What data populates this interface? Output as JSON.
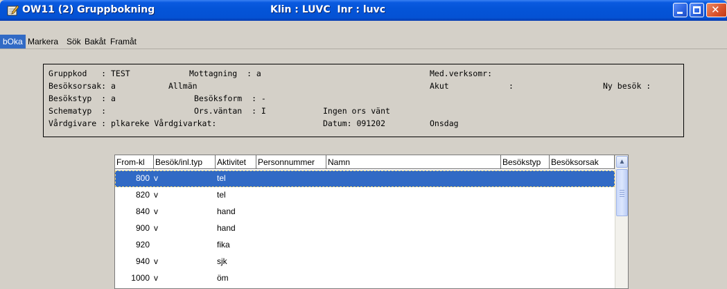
{
  "window": {
    "app_title": "OW11 (2) Gruppbokning",
    "clinic_title": "Klin : LUVC  Inr : luvc",
    "icon": "pencil-notepad-icon",
    "controls": [
      "minimize-icon",
      "maximize-icon",
      "close-icon"
    ]
  },
  "menu": {
    "items": [
      "bOka",
      "Markera",
      "Sök",
      "Bakåt",
      "Framåt"
    ],
    "active_index": 0
  },
  "info": {
    "lines": [
      "Gruppkod   : TEST",
      "Besöksorsak: a",
      "Besökstyp  : a",
      "Schematyp  :",
      "Vårdgivare : plkareke Vårdgivarkat:"
    ],
    "col2": [
      "Mottagning  : a",
      "Allmän",
      "Besöksform  : -",
      "Ors.väntan  : I",
      ""
    ],
    "ingen_ors": "Ingen ors vänt",
    "datum": "Datum: 091202",
    "weekday": "Onsdag",
    "med_verksomr": "Med.verksomr:",
    "akut": "Akut",
    "akut_colon": ":",
    "ny_besok": "Ny besök :"
  },
  "grid": {
    "columns": [
      "From-kl",
      "Besök/inl.typ",
      "Aktivitet",
      "Personnummer",
      "Namn",
      "Besökstyp",
      "Besöksorsak"
    ],
    "rows": [
      {
        "from": "800",
        "typ": "v",
        "aktivitet": "tel"
      },
      {
        "from": "820",
        "typ": "v",
        "aktivitet": "tel"
      },
      {
        "from": "840",
        "typ": "v",
        "aktivitet": "hand"
      },
      {
        "from": "900",
        "typ": "v",
        "aktivitet": "hand"
      },
      {
        "from": "920",
        "typ": "",
        "aktivitet": "fika"
      },
      {
        "from": "940",
        "typ": "v",
        "aktivitet": "sjk"
      },
      {
        "from": "1000",
        "typ": "v",
        "aktivitet": "öm"
      }
    ],
    "selected_row": 0
  },
  "colors": {
    "titlebar": "#0454d8",
    "selection": "#316ac5",
    "window_bg": "#d4d0c8"
  }
}
